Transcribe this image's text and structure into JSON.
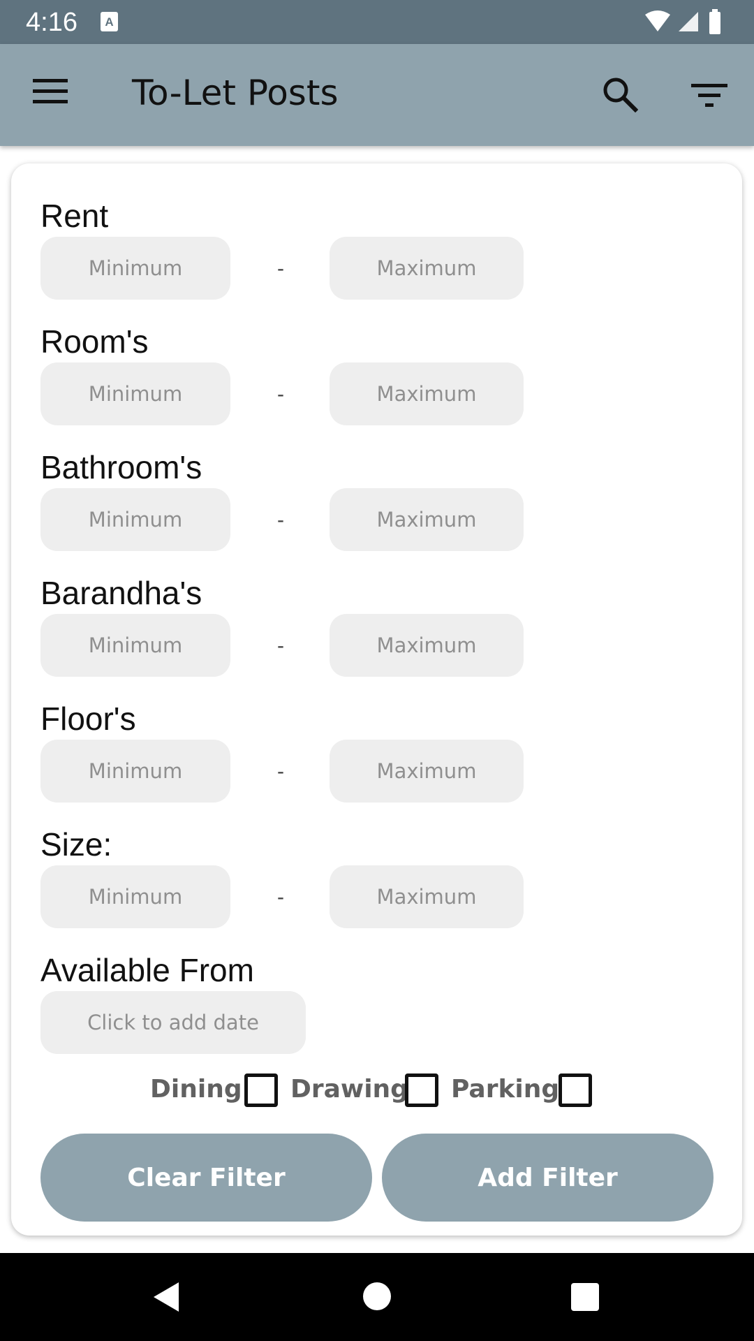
{
  "status_bar": {
    "time": "4:16",
    "notification_icon": "font-a-icon",
    "icons": [
      "wifi-icon",
      "signal-icon",
      "battery-icon"
    ]
  },
  "app_bar": {
    "title": "To-Let Posts",
    "menu_icon": "hamburger-menu-icon",
    "search_icon": "search-icon",
    "filter_icon": "filter-icon",
    "background_color": "#8fa3ad"
  },
  "filters": {
    "rent": {
      "label": "Rent",
      "min_placeholder": "Minimum",
      "max_placeholder": "Maximum",
      "separator": "-"
    },
    "rooms": {
      "label": "Room's",
      "min_placeholder": "Minimum",
      "max_placeholder": "Maximum",
      "separator": "-"
    },
    "bathrooms": {
      "label": "Bathroom's",
      "min_placeholder": "Minimum",
      "max_placeholder": "Maximum",
      "separator": "-"
    },
    "barandhas": {
      "label": "Barandha's",
      "min_placeholder": "Minimum",
      "max_placeholder": "Maximum",
      "separator": "-"
    },
    "floors": {
      "label": "Floor's",
      "min_placeholder": "Minimum",
      "max_placeholder": "Maximum",
      "separator": "-"
    },
    "size": {
      "label": "Size:",
      "min_placeholder": "Minimum",
      "max_placeholder": "Maximum",
      "separator": "-"
    },
    "available_from": {
      "label": "Available From",
      "placeholder": "Click to add date"
    }
  },
  "amenities": [
    {
      "label": "Dining",
      "checked": false
    },
    {
      "label": "Drawing",
      "checked": false
    },
    {
      "label": "Parking",
      "checked": false
    }
  ],
  "buttons": {
    "clear_label": "Clear Filter",
    "add_label": "Add Filter"
  },
  "nav_bar": {
    "back_icon": "back-triangle-icon",
    "home_icon": "home-circle-icon",
    "recents_icon": "recents-square-icon"
  }
}
